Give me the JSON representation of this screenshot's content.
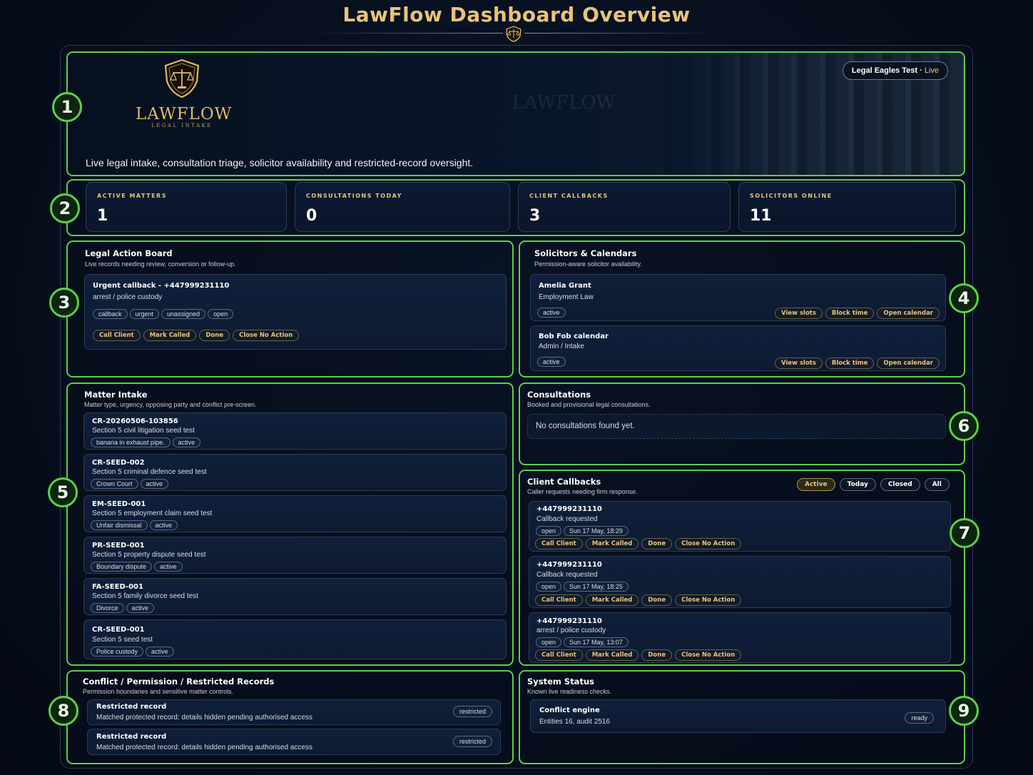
{
  "page": {
    "title": "LawFlow Dashboard Overview"
  },
  "hero": {
    "logo_word": "LAWFLOW",
    "logo_sub": "LEGAL INTAKE",
    "watermark_word": "LAWFLOW",
    "tagline": "Live legal intake, consultation triage, solicitor availability and restricted-record oversight.",
    "workspace": "Legal Eagles Test",
    "workspace_sep": " · ",
    "workspace_status": "Live"
  },
  "stats": [
    {
      "label": "ACTIVE MATTERS",
      "value": "1"
    },
    {
      "label": "CONSULTATIONS TODAY",
      "value": "0"
    },
    {
      "label": "CLIENT CALLBACKS",
      "value": "3"
    },
    {
      "label": "SOLICITORS ONLINE",
      "value": "11"
    }
  ],
  "action_board": {
    "title": "Legal Action Board",
    "subtitle": "Live records needing review, conversion or follow-up.",
    "item": {
      "title": "Urgent callback - +447999231110",
      "subtitle": "arrest / police custody",
      "tags": [
        "callback",
        "urgent",
        "unassigned",
        "open"
      ],
      "buttons": [
        "Call Client",
        "Mark Called",
        "Done",
        "Close No Action"
      ]
    }
  },
  "solicitors": {
    "title": "Solicitors & Calendars",
    "subtitle": "Permission-aware solicitor availability.",
    "items": [
      {
        "name": "Amelia Grant",
        "role": "Employment Law",
        "status": "active"
      },
      {
        "name": "Bob Fob calendar",
        "role": "Admin / Intake",
        "status": "active"
      }
    ],
    "buttons": [
      "View slots",
      "Block time",
      "Open calendar"
    ]
  },
  "matter_intake": {
    "title": "Matter Intake",
    "subtitle": "Matter type, urgency, opposing party and conflict pre-screen.",
    "items": [
      {
        "ref": "CR-20260506-103856",
        "desc": "Section 5 civil litigation seed test",
        "tag": "banana in exhaust pipe.",
        "status": "active"
      },
      {
        "ref": "CR-SEED-002",
        "desc": "Section 5 criminal defence seed test",
        "tag": "Crown Court",
        "status": "active"
      },
      {
        "ref": "EM-SEED-001",
        "desc": "Section 5 employment claim seed test",
        "tag": "Unfair dismissal",
        "status": "active"
      },
      {
        "ref": "PR-SEED-001",
        "desc": "Section 5 property dispute seed test",
        "tag": "Boundary dispute",
        "status": "active"
      },
      {
        "ref": "FA-SEED-001",
        "desc": "Section 5 family divorce seed test",
        "tag": "Divorce",
        "status": "active"
      },
      {
        "ref": "CR-SEED-001",
        "desc": "Section 5 seed test",
        "tag": "Police custody",
        "status": "active"
      }
    ]
  },
  "consultations": {
    "title": "Consultations",
    "subtitle": "Booked and provisional legal consultations.",
    "empty": "No consultations found yet."
  },
  "callbacks": {
    "title": "Client Callbacks",
    "subtitle": "Caller requests needing firm response.",
    "filters": [
      "Active",
      "Today",
      "Closed",
      "All"
    ],
    "items": [
      {
        "phone": "+447999231110",
        "desc": "Callback requested",
        "status": "open",
        "time": "Sun 17 May, 18:29"
      },
      {
        "phone": "+447999231110",
        "desc": "Callback requested",
        "status": "open",
        "time": "Sun 17 May, 18:25"
      },
      {
        "phone": "+447999231110",
        "desc": "arrest / police custody",
        "status": "open",
        "time": "Sun 17 May, 13:07"
      }
    ],
    "buttons": [
      "Call Client",
      "Mark Called",
      "Done",
      "Close No Action"
    ]
  },
  "restricted": {
    "title": "Conflict / Permission / Restricted Records",
    "subtitle": "Permission boundaries and sensitive matter controls.",
    "items": [
      {
        "title": "Restricted record",
        "desc": "Matched protected record: details hidden pending authorised access",
        "tag": "restricted"
      },
      {
        "title": "Restricted record",
        "desc": "Matched protected record: details hidden pending authorised access",
        "tag": "restricted"
      }
    ]
  },
  "system_status": {
    "title": "System Status",
    "subtitle": "Known live readiness checks.",
    "item": {
      "title": "Conflict engine",
      "desc": "Entities 16, audit 2516",
      "status": "ready"
    }
  },
  "badges": [
    "1",
    "2",
    "3",
    "4",
    "5",
    "6",
    "7",
    "8",
    "9"
  ],
  "colors": {
    "accent_gold": "#e8c37a",
    "zone_green": "#5ad145",
    "background": "#060d1a"
  }
}
